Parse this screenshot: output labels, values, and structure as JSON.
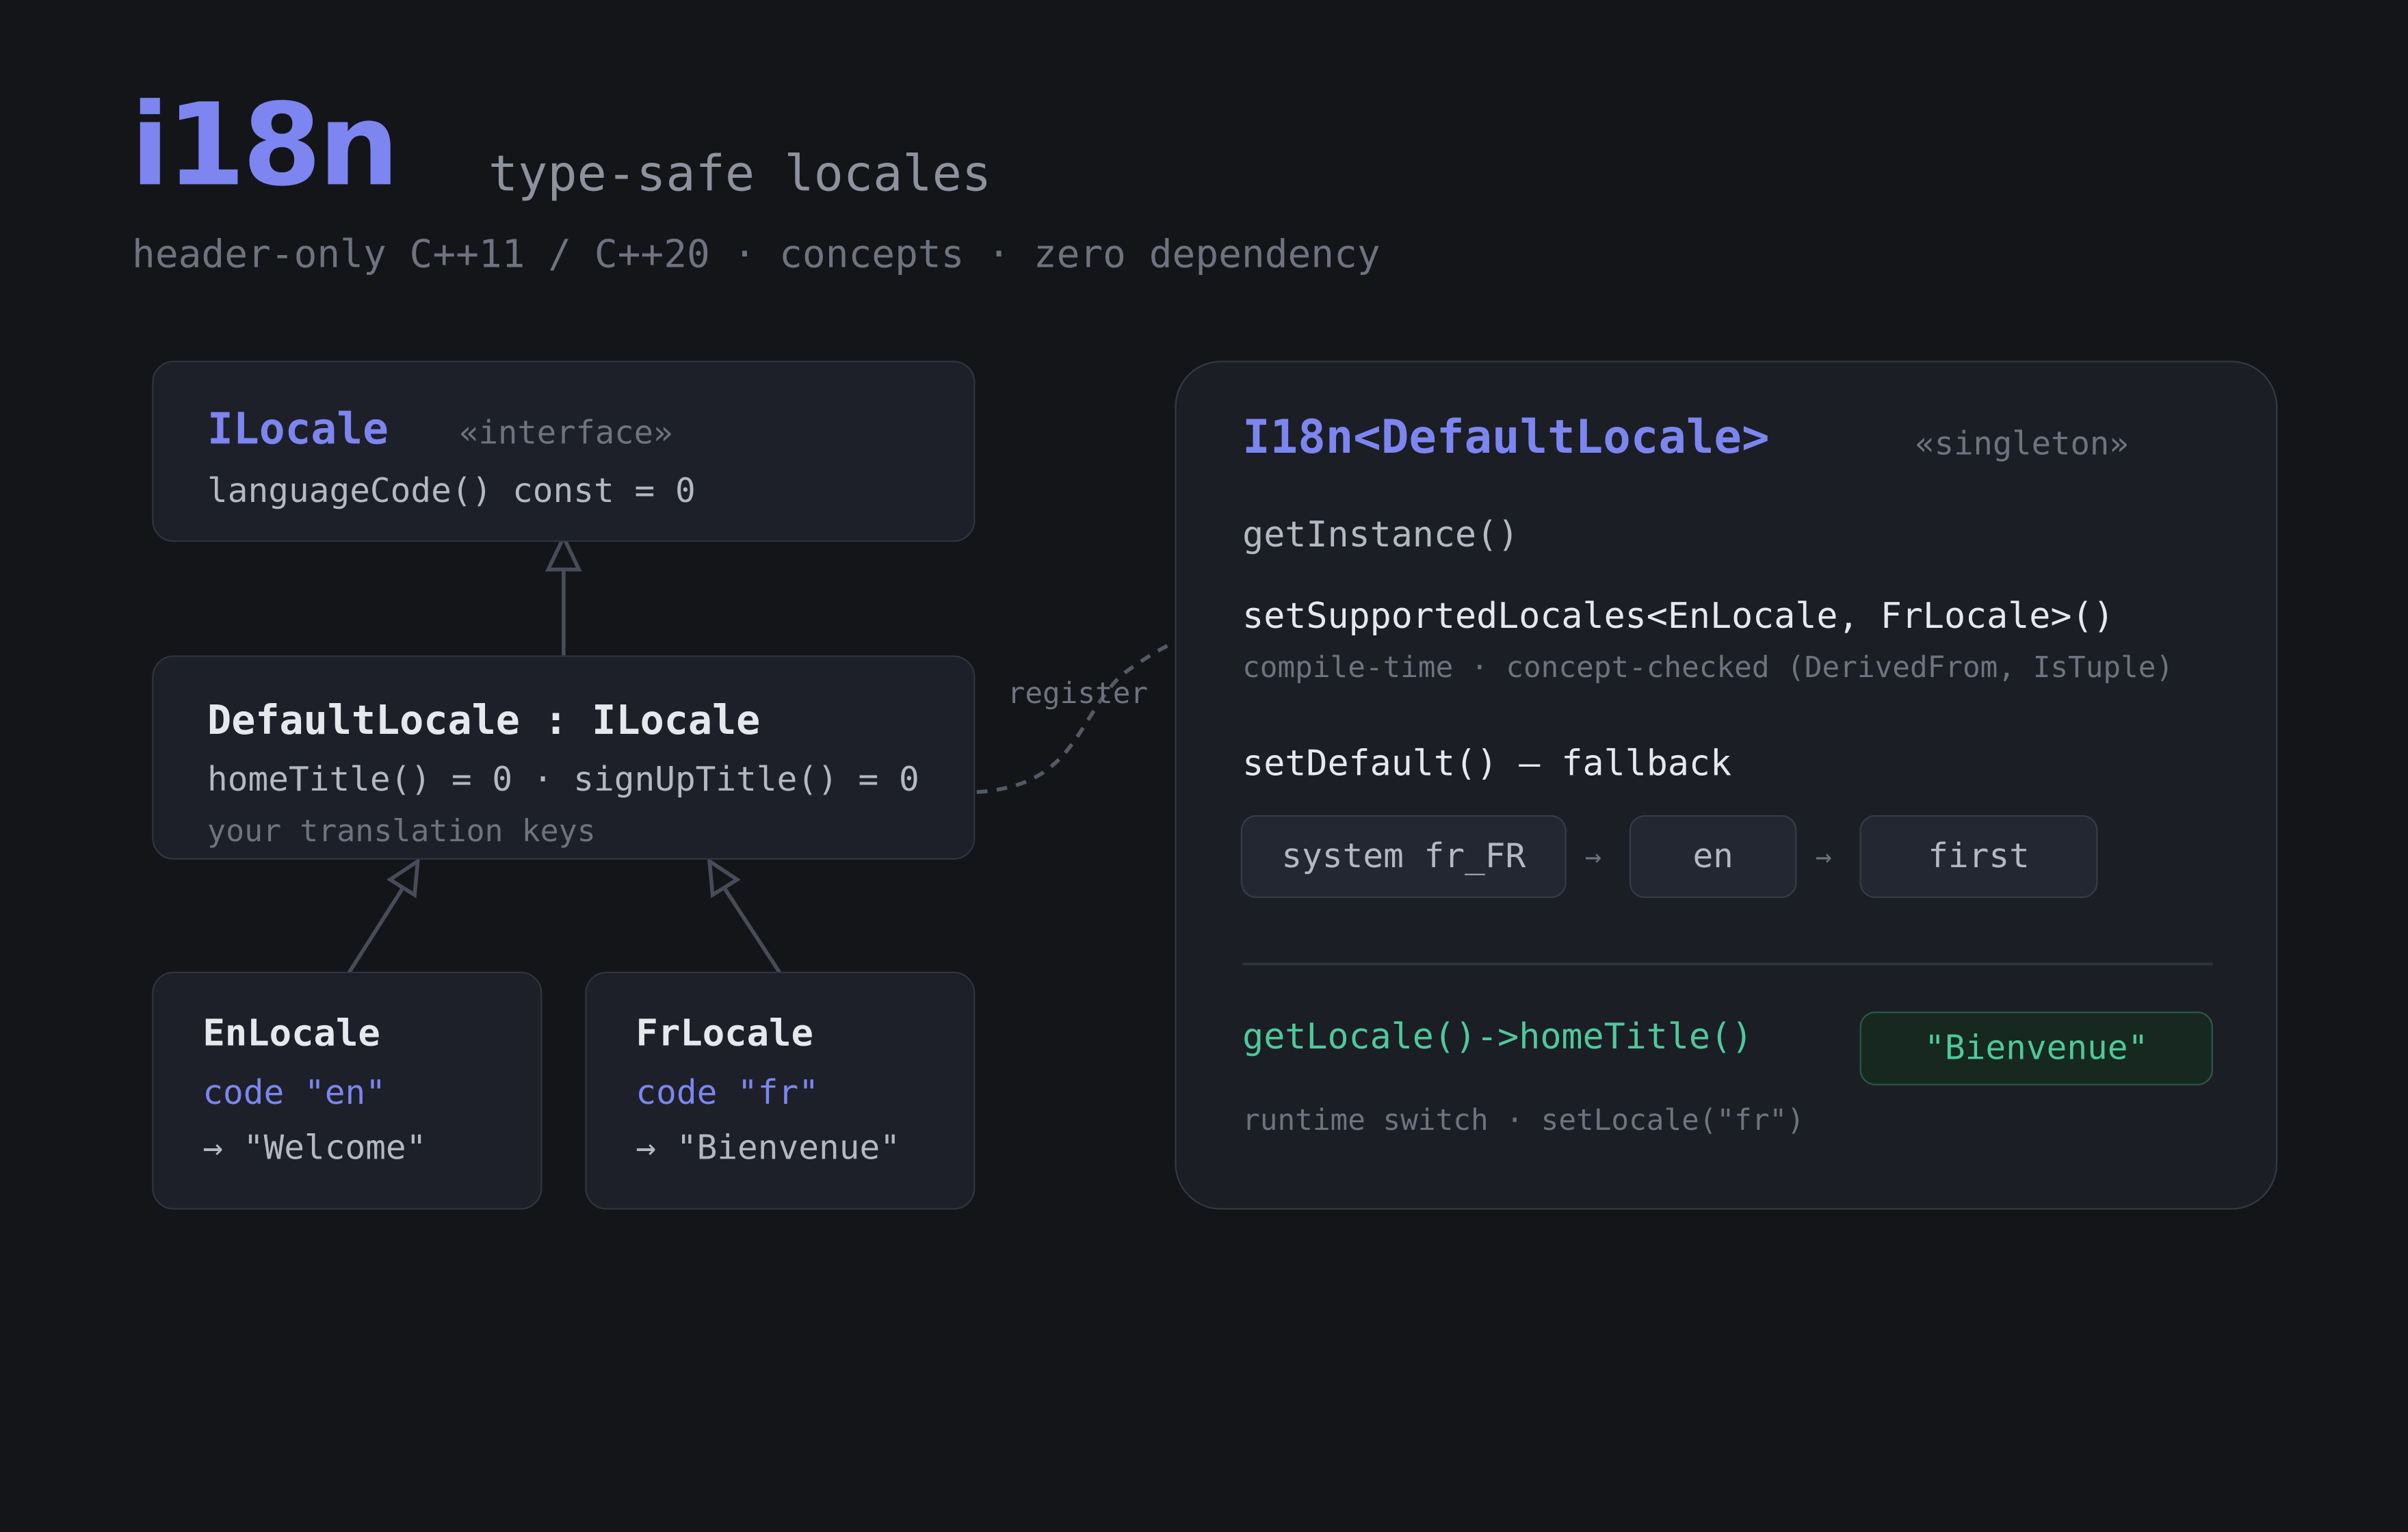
{
  "header": {
    "logo": "i18n",
    "tagline": "type-safe locales",
    "subtitle": "header-only C++11 / C++20 · concepts · zero dependency"
  },
  "ilocale": {
    "name": "ILocale",
    "stereotype": "«interface»",
    "member": "languageCode() const = 0"
  },
  "default_locale": {
    "name": "DefaultLocale : ILocale",
    "members": "homeTitle() = 0 · signUpTitle() = 0",
    "note": "your translation keys"
  },
  "en_locale": {
    "name": "EnLocale",
    "code": "code \"en\"",
    "value": "→ \"Welcome\""
  },
  "fr_locale": {
    "name": "FrLocale",
    "code": "code \"fr\"",
    "value": "→ \"Bienvenue\""
  },
  "register_label": "register",
  "singleton": {
    "name": "I18n<DefaultLocale>",
    "stereotype": "«singleton»",
    "get_instance": "getInstance()",
    "set_supported": "setSupportedLocales<EnLocale, FrLocale>()",
    "set_supported_note": "compile-time · concept-checked (DerivedFrom, IsTuple)",
    "set_default": "setDefault() — fallback",
    "fallback_chain": [
      "system fr_FR",
      "en",
      "first"
    ],
    "arrow": "→",
    "get_locale": "getLocale()->homeTitle()",
    "result": "\"Bienvenue\"",
    "runtime_note": "runtime switch · setLocale(\"fr\")"
  },
  "colors": {
    "background": "#141519",
    "box": "#1d2028",
    "accent": "#7c85f0",
    "green": "#4ec99a",
    "text": "#e6e8ee",
    "muted": "#8d929e"
  }
}
